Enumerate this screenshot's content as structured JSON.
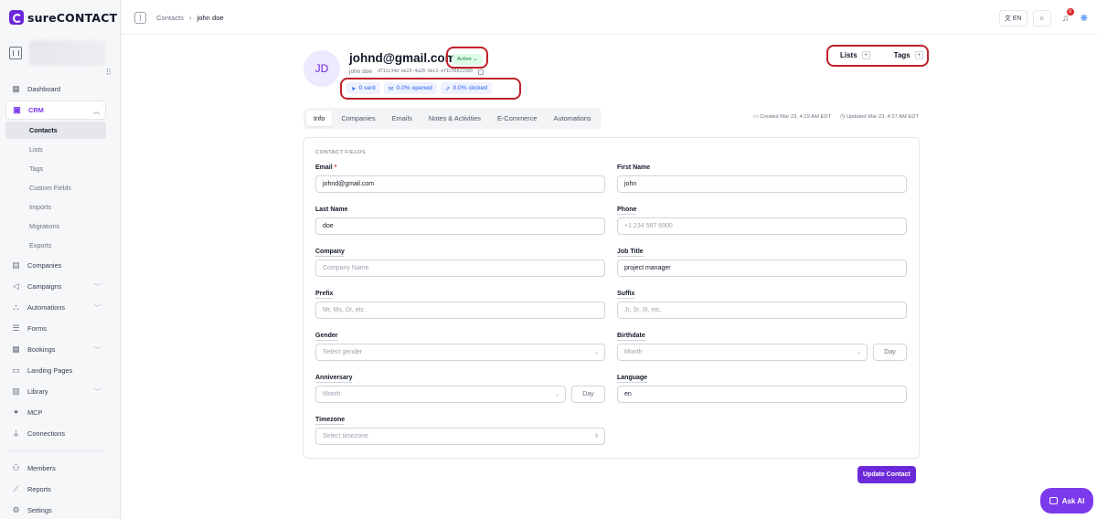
{
  "brand": {
    "name": "sureCONTACT",
    "accent": "#6d28d9"
  },
  "sidebar": {
    "items_top": [
      {
        "label": "Dashboard",
        "icon": "dashboard-icon"
      },
      {
        "label": "CRM",
        "icon": "contact-card-icon"
      }
    ],
    "crm_sub": [
      "Contacts",
      "Lists",
      "Tags",
      "Custom Fields",
      "Imports",
      "Migrations",
      "Exports"
    ],
    "items_mid": [
      {
        "label": "Companies",
        "icon": "building-icon",
        "chevron": false
      },
      {
        "label": "Campaigns",
        "icon": "megaphone-icon",
        "chevron": true
      },
      {
        "label": "Automations",
        "icon": "workflow-icon",
        "chevron": true
      },
      {
        "label": "Forms",
        "icon": "form-icon",
        "chevron": false
      },
      {
        "label": "Bookings",
        "icon": "calendar-icon",
        "chevron": true
      },
      {
        "label": "Landing Pages",
        "icon": "layout-icon",
        "chevron": false
      },
      {
        "label": "Library",
        "icon": "library-icon",
        "chevron": true
      },
      {
        "label": "MCP",
        "icon": "mcp-icon",
        "chevron": false
      },
      {
        "label": "Connections",
        "icon": "plug-icon",
        "chevron": false
      }
    ],
    "items_bottom": [
      {
        "label": "Members",
        "icon": "users-icon"
      },
      {
        "label": "Reports",
        "icon": "chart-icon"
      },
      {
        "label": "Settings",
        "icon": "gear-icon"
      }
    ]
  },
  "topbar": {
    "breadcrumb": [
      "Contacts",
      "john doe"
    ],
    "lang": "EN",
    "notifications": "6"
  },
  "contact": {
    "initials": "JD",
    "email": "johnd@gmail.com",
    "status": "Active",
    "name": "john doe",
    "uuid": "d711c34d-be23-4a28-9ec1-ef1c56021580",
    "stats": {
      "sent": "0 sent",
      "opened": "0.0% opened",
      "clicked": "0.0% clicked"
    },
    "lists_label": "Lists",
    "tags_label": "Tags"
  },
  "tabs": [
    "Info",
    "Companies",
    "Emails",
    "Notes & Activities",
    "E-Commerce",
    "Automations"
  ],
  "meta": {
    "created": "Created Mar 23, 4:19 AM EDT",
    "updated": "Updated Mar 23, 4:27 AM EDT"
  },
  "form": {
    "section_title": "CONTACT FIELDS",
    "email": {
      "label": "Email",
      "value": "johnd@gmail.com"
    },
    "first_name": {
      "label": "First Name",
      "value": "john"
    },
    "last_name": {
      "label": "Last Name",
      "value": "doe"
    },
    "phone": {
      "label": "Phone",
      "placeholder": "+1 234 567 8900"
    },
    "company": {
      "label": "Company",
      "placeholder": "Company Name"
    },
    "job_title": {
      "label": "Job Title",
      "value": "project manager"
    },
    "prefix": {
      "label": "Prefix",
      "placeholder": "Mr, Ms, Dr, etc."
    },
    "suffix": {
      "label": "Suffix",
      "placeholder": "Jr, Sr, III, etc."
    },
    "gender": {
      "label": "Gender",
      "placeholder": "Select gender"
    },
    "birthdate": {
      "label": "Birthdate",
      "month": "Month",
      "day": "Day"
    },
    "anniversary": {
      "label": "Anniversary",
      "month": "Month",
      "day": "Day"
    },
    "language": {
      "label": "Language",
      "value": "en"
    },
    "timezone": {
      "label": "Timezone",
      "placeholder": "Select timezone"
    },
    "submit": "Update Contact"
  },
  "ask_ai": "Ask AI"
}
